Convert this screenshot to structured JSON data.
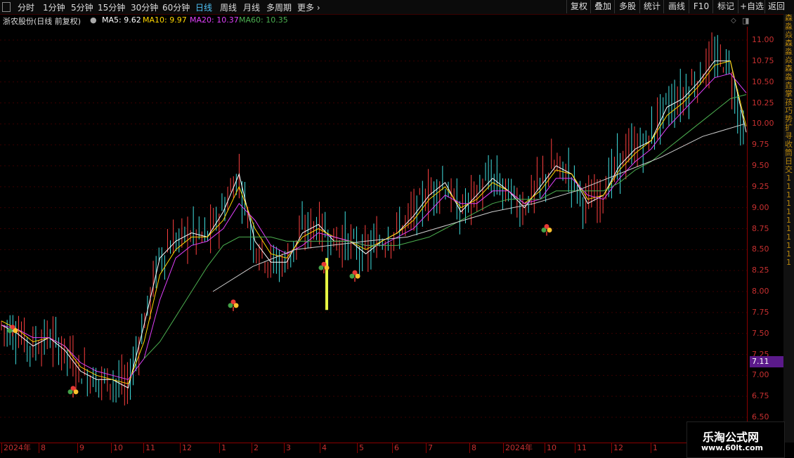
{
  "toolbar": {
    "periods": [
      "分时",
      "1分钟",
      "5分钟",
      "15分钟",
      "30分钟",
      "60分钟",
      "日线",
      "周线",
      "月线",
      "多周期",
      "更多"
    ],
    "active_period": "日线",
    "tools": [
      "复权",
      "叠加",
      "多股",
      "统计",
      "画线",
      "F10",
      "标记",
      "+自选",
      "返回"
    ]
  },
  "info": {
    "stock": "浙农股份(日线 前复权)",
    "ma5": "MA5: 9.62",
    "ma10": "MA10: 9.97",
    "ma20": "MA20: 10.37",
    "ma60": "MA60: 10.35"
  },
  "colors": {
    "ma5": "#ffffff",
    "ma10": "#ffd700",
    "ma20": "#e040fb",
    "ma60": "#4caf50",
    "ma_long": "#d0d0d0",
    "up": "#ff4040",
    "down": "#40e0e0",
    "axis": "#c83030"
  },
  "yaxis": {
    "labels": [
      "11.00",
      "10.75",
      "10.50",
      "10.25",
      "10.00",
      "9.75",
      "9.50",
      "9.25",
      "9.00",
      "8.75",
      "8.50",
      "8.25",
      "8.00",
      "7.75",
      "7.50",
      "7.25",
      "7.00",
      "6.75",
      "6.50"
    ],
    "min": 6.5,
    "max": 11.0
  },
  "last_price": "7.11",
  "xaxis": {
    "labels": [
      "2024年",
      "8",
      "9",
      "10",
      "11",
      "12",
      "1",
      "2",
      "3",
      "4",
      "5",
      "6",
      "7",
      "8",
      "2024年",
      "10",
      "11",
      "12",
      "1"
    ]
  },
  "right_strip": [
    "森",
    "淼",
    "焱",
    "森",
    "淼",
    "焱",
    "森",
    "淼",
    "垚",
    "掌",
    "孩",
    "巧",
    "势",
    "扩",
    "寻",
    "收",
    "筒",
    "日",
    "交",
    "1",
    "1",
    "1",
    "1",
    "1",
    "1",
    "1",
    "1",
    "1",
    "1",
    "1"
  ],
  "watermark": {
    "line1": "乐淘公式网",
    "line2": "www.60lt.com"
  },
  "chart_data": {
    "type": "line",
    "title": "浙农股份(日线 前复权)",
    "ylim": [
      6.5,
      11.0
    ],
    "series": [
      {
        "name": "MA5",
        "values": [
          7.6,
          7.5,
          7.35,
          7.45,
          7.3,
          7.05,
          6.95,
          6.95,
          6.85,
          7.6,
          8.4,
          8.6,
          8.7,
          8.65,
          8.95,
          9.4,
          8.6,
          8.35,
          8.35,
          8.7,
          8.8,
          8.6,
          8.6,
          8.45,
          8.6,
          8.7,
          8.9,
          9.15,
          9.3,
          8.95,
          9.15,
          9.35,
          9.2,
          9.0,
          9.25,
          9.5,
          9.4,
          9.05,
          9.15,
          9.5,
          9.7,
          9.8,
          10.2,
          10.3,
          10.5,
          10.75,
          10.75,
          9.9
        ]
      },
      {
        "name": "MA10",
        "values": [
          7.65,
          7.55,
          7.4,
          7.45,
          7.35,
          7.1,
          7.0,
          6.95,
          6.9,
          7.4,
          8.2,
          8.5,
          8.65,
          8.65,
          8.85,
          9.25,
          8.75,
          8.45,
          8.4,
          8.65,
          8.75,
          8.65,
          8.6,
          8.5,
          8.6,
          8.7,
          8.85,
          9.1,
          9.25,
          9.0,
          9.1,
          9.3,
          9.2,
          9.05,
          9.2,
          9.45,
          9.4,
          9.1,
          9.15,
          9.45,
          9.65,
          9.8,
          10.1,
          10.25,
          10.45,
          10.7,
          10.75,
          9.97
        ]
      },
      {
        "name": "MA20",
        "values": [
          7.6,
          7.55,
          7.45,
          7.45,
          7.35,
          7.15,
          7.05,
          7.0,
          6.95,
          7.2,
          7.9,
          8.4,
          8.55,
          8.6,
          8.75,
          9.05,
          8.85,
          8.55,
          8.45,
          8.55,
          8.7,
          8.65,
          8.6,
          8.55,
          8.55,
          8.65,
          8.75,
          8.95,
          9.15,
          9.05,
          9.05,
          9.2,
          9.2,
          9.05,
          9.1,
          9.35,
          9.35,
          9.15,
          9.1,
          9.35,
          9.55,
          9.7,
          9.95,
          10.15,
          10.35,
          10.55,
          10.6,
          10.37
        ]
      },
      {
        "name": "MA60",
        "values": [
          null,
          null,
          null,
          null,
          null,
          null,
          null,
          null,
          null,
          7.2,
          7.4,
          7.7,
          8.0,
          8.3,
          8.55,
          8.65,
          8.65,
          8.65,
          8.6,
          8.6,
          8.6,
          8.6,
          8.6,
          8.55,
          8.55,
          8.55,
          8.6,
          8.65,
          8.75,
          8.85,
          8.95,
          9.05,
          9.1,
          9.1,
          9.1,
          9.2,
          9.2,
          9.2,
          9.2,
          9.3,
          9.45,
          9.55,
          9.7,
          9.85,
          10.0,
          10.15,
          10.3,
          10.35
        ]
      }
    ],
    "marker_labels": []
  }
}
